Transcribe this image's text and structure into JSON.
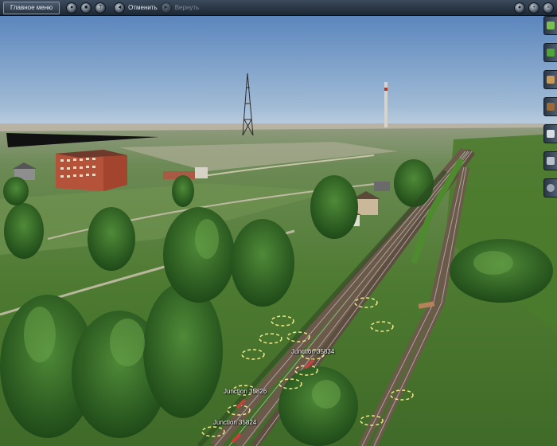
{
  "toolbar": {
    "main_menu_label": "Главное меню",
    "undo_label": "Отменить",
    "redo_label": "Вернуть"
  },
  "scene": {
    "junction_labels": [
      "Junction 35834",
      "Junction 35826",
      "Junction 35824"
    ]
  },
  "colors": {
    "sky_top": "#5b86bd",
    "sky_horizon": "#c9d6e2",
    "grass": "#4f7a2f",
    "track": "#6b5a4a",
    "marker": "#f3e98a"
  }
}
